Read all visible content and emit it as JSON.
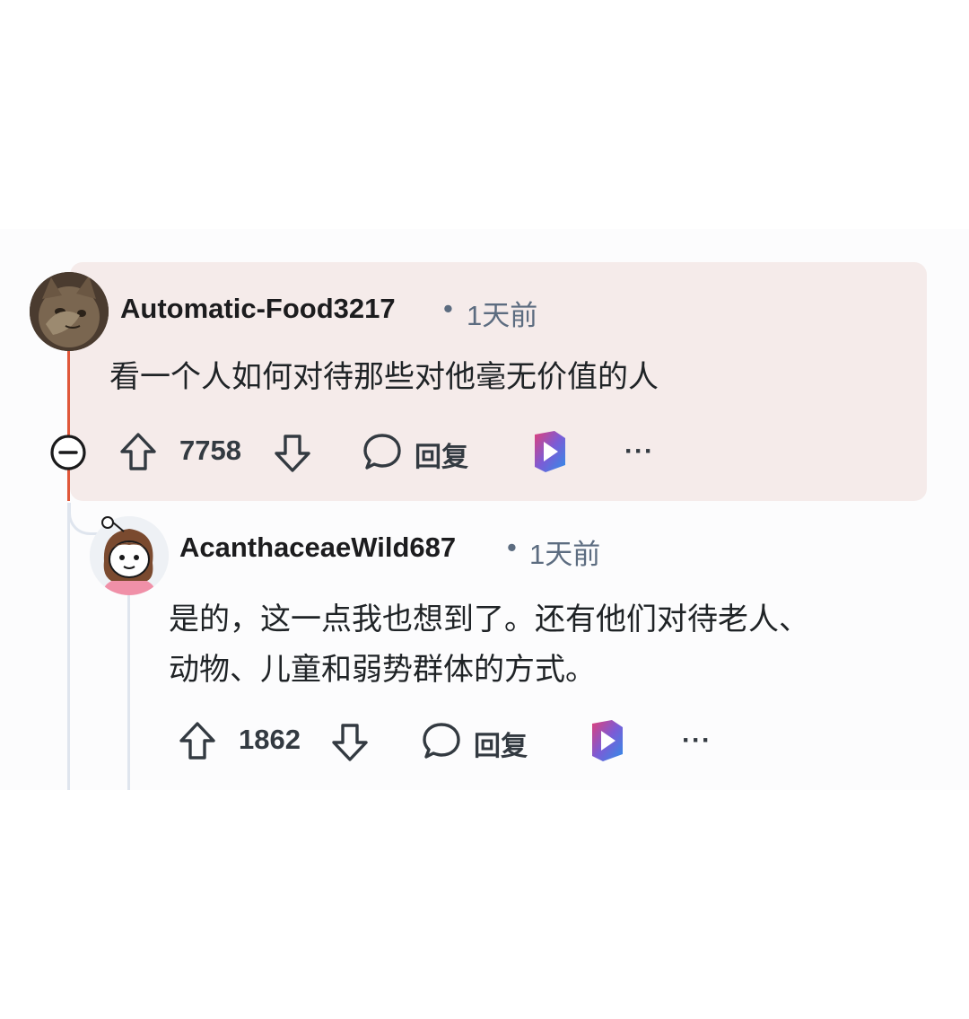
{
  "comments": [
    {
      "username": "Automatic-Food3217",
      "separator": "•",
      "time": "1天前",
      "body": "看一个人如何对待那些对他毫无价值的人",
      "score": "7758",
      "reply_label": "回复",
      "more_label": "···"
    },
    {
      "username": "AcanthaceaeWild687",
      "separator": "•",
      "time": "1天前",
      "body_lines": [
        "是的，这一点我也想到了。还有他们对待老人、",
        "动物、儿童和弱势群体的方式。"
      ],
      "score": "1862",
      "reply_label": "回复",
      "more_label": "···"
    }
  ],
  "colors": {
    "highlight_bg": "#f5ebea",
    "thread_active": "#e0573a",
    "thread_idle": "#dfe5ee",
    "meta_text": "#5c6c80"
  },
  "icons": [
    "collapse-icon",
    "upvote-icon",
    "downvote-icon",
    "comment-bubble-icon",
    "app-logo-icon",
    "avatar-cat",
    "avatar-snoo-girl"
  ]
}
